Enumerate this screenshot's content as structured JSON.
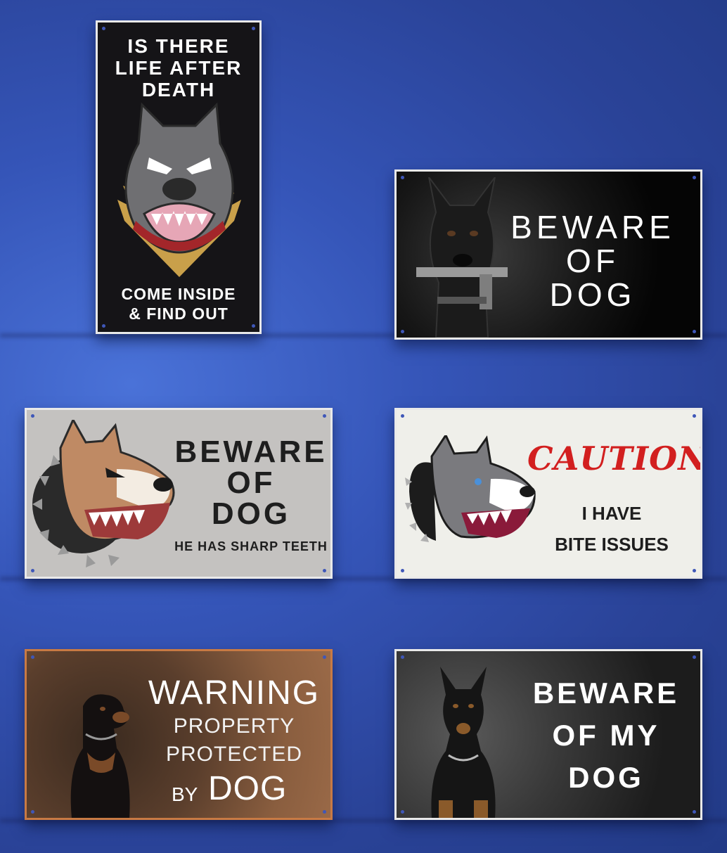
{
  "signs": [
    {
      "lines": [
        "IS THERE",
        "LIFE AFTER",
        "DEATH"
      ],
      "footer": [
        "COME INSIDE",
        "& FIND OUT"
      ]
    },
    {
      "lines": [
        "BEWARE",
        "OF",
        "DOG"
      ]
    },
    {
      "lines": [
        "BEWARE",
        "OF",
        "DOG"
      ],
      "subtitle": "HE HAS SHARP TEETH"
    },
    {
      "title": "CAUTION",
      "lines": [
        "I HAVE",
        "BITE ISSUES"
      ]
    },
    {
      "title": "WARNING",
      "lines": [
        "PROPERTY",
        "PROTECTED"
      ],
      "by": "BY",
      "dog": "DOG"
    },
    {
      "lines": [
        "BEWARE",
        "OF MY",
        "DOG"
      ]
    }
  ],
  "colors": {
    "background": "#3555b8",
    "caution_red": "#d21f1f",
    "warning_border": "#c87a44"
  },
  "icons": [
    "pitbull-head-icon",
    "doberman-with-gun-icon",
    "pitbull-snarl-icon",
    "pitbull-spiked-collar-icon",
    "rottweiler-icon",
    "doberman-icon"
  ]
}
